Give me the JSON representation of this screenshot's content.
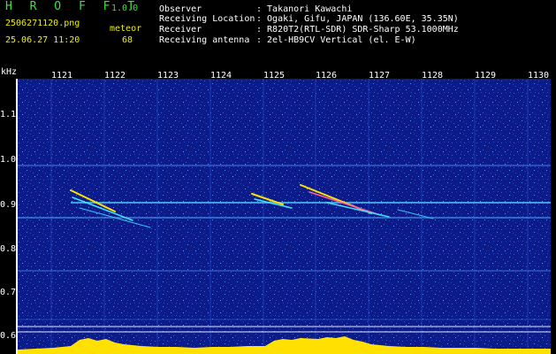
{
  "header": {
    "app_name": "H R O F F T",
    "app_version": "1.0.0",
    "filename": "2506271120.png",
    "datetime": "25.06.27 11:20",
    "meteor_label": "meteor",
    "meteor_count": "68",
    "fields": [
      {
        "label": "Observer",
        "value": ": Takanori Kawachi"
      },
      {
        "label": "Receiving Location",
        "value": ": Ogaki, Gifu, JAPAN (136.60E, 35.35N)"
      },
      {
        "label": "Receiver",
        "value": ": R820T2(RTL-SDR) SDR-Sharp 53.1000MHz"
      },
      {
        "label": "Receiving antenna",
        "value": ": 2el-HB9CV Vertical (el. E-W)"
      }
    ]
  },
  "axis": {
    "unit": "kHz",
    "y_ticks": [
      "1.1",
      "1.0",
      "0.9",
      "0.8",
      "0.7",
      "0.6"
    ],
    "x_ticks": [
      "1121",
      "1122",
      "1123",
      "1124",
      "1125",
      "1126",
      "1127",
      "1128",
      "1129",
      "1130"
    ]
  },
  "colors": {
    "background": "#0b1c8a",
    "header_green": "#3fe03f",
    "header_yellow": "#f0f000",
    "signal_yellow": "#ffe000",
    "signal_cyan": "#40e0ff"
  }
}
